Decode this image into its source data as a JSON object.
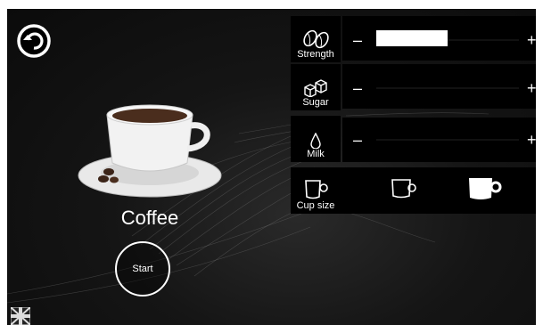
{
  "product": {
    "name": "Coffee",
    "start_label": "Start"
  },
  "settings": {
    "strength": {
      "label": "Strength",
      "minus": "–",
      "plus": "+",
      "level": 0.5
    },
    "sugar": {
      "label": "Sugar",
      "minus": "–",
      "plus": "+",
      "level": 0
    },
    "milk": {
      "label": "Milk",
      "minus": "–",
      "plus": "+",
      "level": 0
    }
  },
  "cup_size": {
    "label": "Cup size",
    "options": [
      "small-cup-icon",
      "medium-cup-icon",
      "large-cup-icon"
    ],
    "selected": "large"
  },
  "icons": {
    "back": "back-arrow-icon",
    "strength": "coffee-beans-icon",
    "sugar": "sugar-cubes-icon",
    "milk": "milk-drop-icon",
    "language": "uk-flag-icon"
  },
  "colors": {
    "background": "#141414",
    "foreground": "#ffffff",
    "panel": "#000000"
  }
}
